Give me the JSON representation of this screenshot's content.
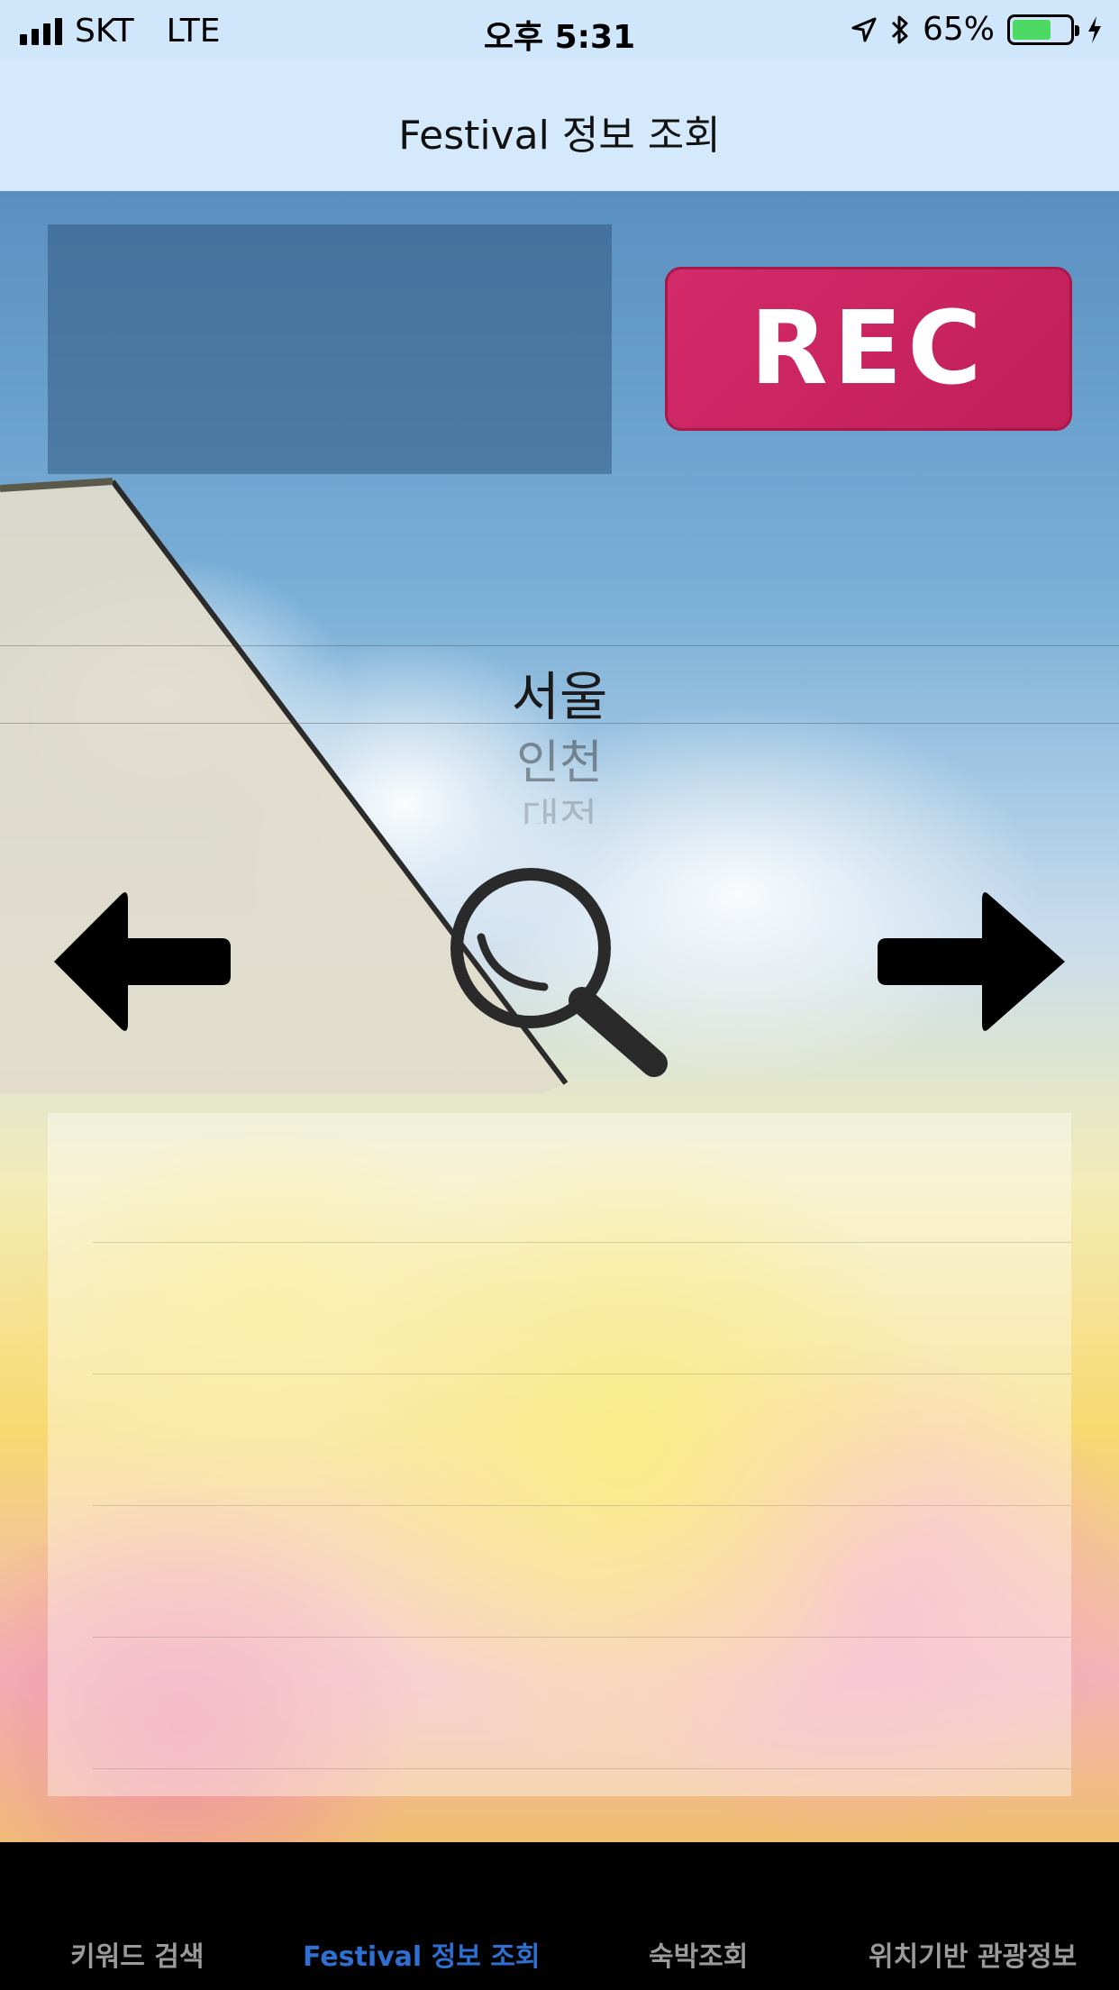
{
  "status_bar": {
    "carrier": "SKT",
    "network": "LTE",
    "time": "오후 5:31",
    "battery_percent": "65%",
    "battery_level": 0.65,
    "icons": [
      "signal-icon",
      "location-arrow-icon",
      "bluetooth-icon",
      "battery-icon",
      "charging-icon"
    ]
  },
  "nav": {
    "title": "Festival 정보 조회"
  },
  "rec_button": {
    "label": "REC",
    "color": "#cc2464"
  },
  "picker": {
    "items": [
      "서울",
      "인천",
      "대전"
    ],
    "selected_index": 0
  },
  "controls": {
    "left_icon": "arrow-left-icon",
    "right_icon": "arrow-right-icon",
    "search_icon": "magnifier-icon"
  },
  "results": {
    "rows": [
      "",
      "",
      "",
      "",
      ""
    ]
  },
  "tabs": [
    {
      "label": "키워드 검색",
      "active": false
    },
    {
      "label": "Festival 정보 조회",
      "active": true
    },
    {
      "label": "숙박조회",
      "active": false
    },
    {
      "label": "위치기반 관광정보",
      "active": false
    }
  ],
  "colors": {
    "accent": "#2e6fd0",
    "tab_inactive": "#9a9a9a",
    "nav_background": "#d5e9fc"
  }
}
